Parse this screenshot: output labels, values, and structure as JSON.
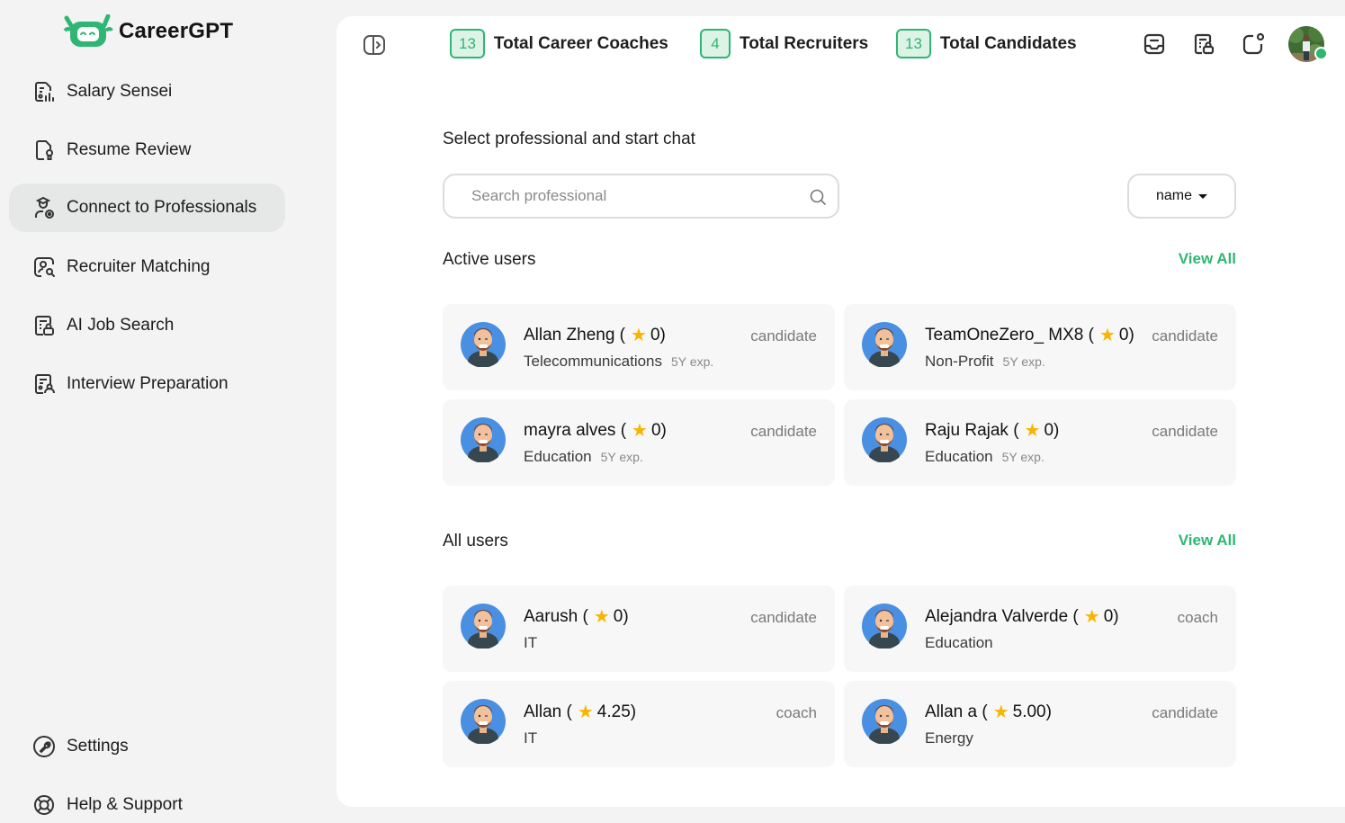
{
  "app": {
    "name": "CareerGPT",
    "brand_color": "#2fb673"
  },
  "sidebar": {
    "items": [
      {
        "label": "Salary Sensei",
        "icon": "salary-report-icon",
        "active": false
      },
      {
        "label": "Resume Review",
        "icon": "resume-badge-icon",
        "active": false
      },
      {
        "label": "Connect to Professionals",
        "icon": "graduate-user-icon",
        "active": true
      },
      {
        "label": "Recruiter Matching",
        "icon": "user-search-icon",
        "active": false
      },
      {
        "label": "AI Job Search",
        "icon": "job-lock-icon",
        "active": false
      },
      {
        "label": "Interview Preparation",
        "icon": "interview-doc-icon",
        "active": false
      }
    ],
    "bottom_items": [
      {
        "label": "Settings",
        "icon": "settings-wrench-icon"
      },
      {
        "label": "Help & Support",
        "icon": "lifebuoy-icon"
      }
    ]
  },
  "topbar": {
    "stats": [
      {
        "count": "13",
        "label": "Total Career Coaches"
      },
      {
        "count": "4",
        "label": "Total Recruiters"
      },
      {
        "count": "13",
        "label": "Total Candidates"
      }
    ],
    "icons": [
      "inbox-icon",
      "job-lock-icon",
      "notification-icon"
    ],
    "user_status": "online"
  },
  "main": {
    "title": "Select professional and start chat",
    "search": {
      "placeholder": "Search professional",
      "value": ""
    },
    "sort": {
      "selected": "name"
    },
    "active_users": {
      "title": "Active users",
      "view_all": "View All",
      "users": [
        {
          "name": "Allan Zheng (",
          "rating": "0)",
          "industry": "Telecommunications",
          "exp": "5Y exp.",
          "role": "candidate"
        },
        {
          "name": "TeamOneZero_ MX8 (",
          "rating": "0)",
          "industry": "Non-Profit",
          "exp": "5Y exp.",
          "role": "candidate"
        },
        {
          "name": "mayra alves (",
          "rating": "0)",
          "industry": "Education",
          "exp": "5Y exp.",
          "role": "candidate"
        },
        {
          "name": "Raju Rajak (",
          "rating": "0)",
          "industry": "Education",
          "exp": "5Y exp.",
          "role": "candidate"
        }
      ]
    },
    "all_users": {
      "title": "All users",
      "view_all": "View All",
      "users": [
        {
          "name": "Aarush (",
          "rating": "0)",
          "industry": "IT",
          "exp": "",
          "role": "candidate"
        },
        {
          "name": "Alejandra Valverde (",
          "rating": "0)",
          "industry": "Education",
          "exp": "",
          "role": "coach"
        },
        {
          "name": "Allan (",
          "rating": "4.25)",
          "industry": "IT",
          "exp": "",
          "role": "coach"
        },
        {
          "name": "Allan a (",
          "rating": "5.00)",
          "industry": "Energy",
          "exp": "",
          "role": "candidate"
        }
      ]
    }
  }
}
